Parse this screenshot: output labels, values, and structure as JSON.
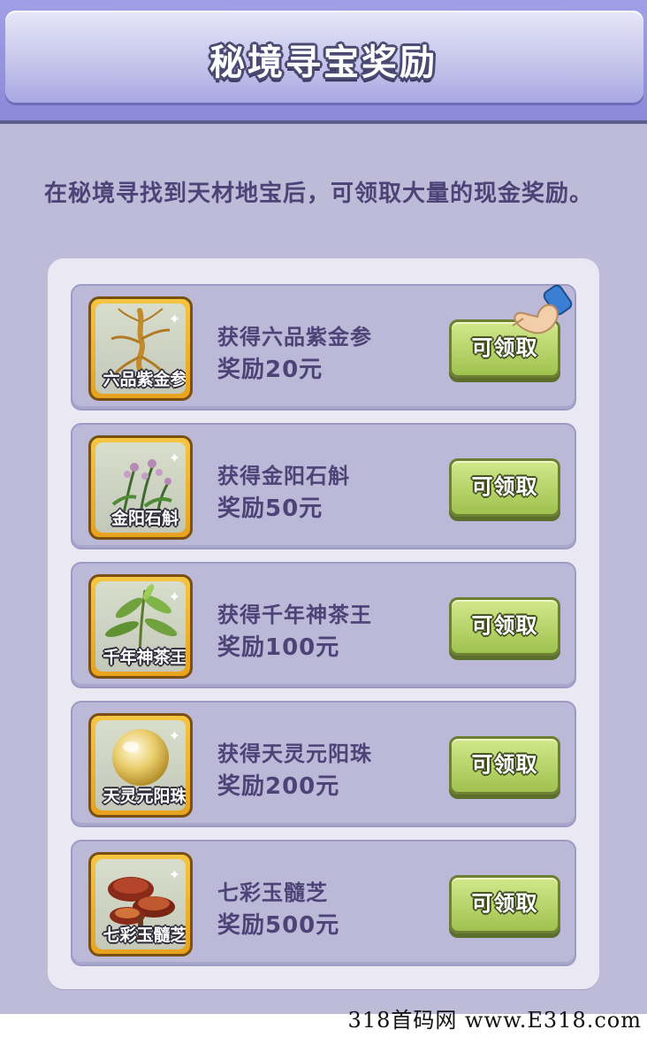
{
  "header": {
    "title": "秘境寻宝奖励"
  },
  "description": "在秘境寻找到天材地宝后，可领取大量的现金奖励。",
  "rewards": [
    {
      "item_name": "六品紫金参",
      "line1": "获得六品紫金参",
      "line2": "奖励20元",
      "button_label": "可领取",
      "icon": "ginseng-icon"
    },
    {
      "item_name": "金阳石斛",
      "line1": "获得金阳石斛",
      "line2": "奖励50元",
      "button_label": "可领取",
      "icon": "orchid-icon"
    },
    {
      "item_name": "千年神茶王",
      "line1": "获得千年神茶王",
      "line2": "奖励100元",
      "button_label": "可领取",
      "icon": "tea-leaf-icon"
    },
    {
      "item_name": "天灵元阳珠",
      "line1": "获得天灵元阳珠",
      "line2": "奖励200元",
      "button_label": "可领取",
      "icon": "pearl-icon"
    },
    {
      "item_name": "七彩玉髓芝",
      "line1": "七彩玉髓芝",
      "line2": "奖励500元",
      "button_label": "可领取",
      "icon": "lingzhi-mushroom-icon"
    }
  ],
  "pointer": {
    "icon": "pointing-hand-icon"
  },
  "watermark": "318首码网 www.E318.com",
  "colors": {
    "panel": "#bebbd9",
    "text": "#4c4477",
    "button": "#b5d46a",
    "frame": "#f0b530"
  }
}
